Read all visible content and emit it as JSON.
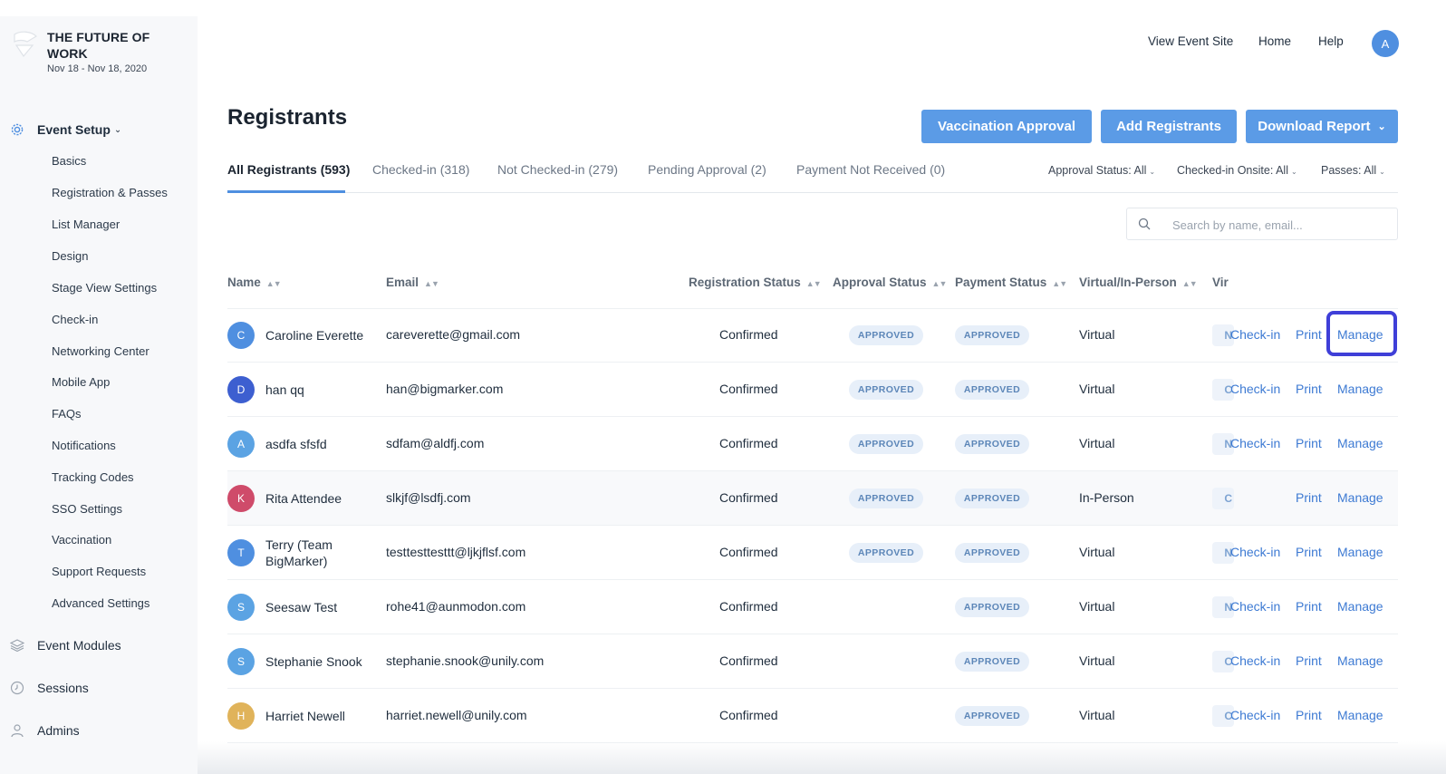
{
  "event": {
    "title": "THE FUTURE OF WORK",
    "dates": "Nov 18 - Nov 18, 2020"
  },
  "sidebar": {
    "event_setup": {
      "label": "Event Setup",
      "icon": "gear-icon"
    },
    "sub_items": [
      "Basics",
      "Registration & Passes",
      "List Manager",
      "Design",
      "Stage View Settings",
      "Check-in",
      "Networking Center",
      "Mobile App",
      "FAQs",
      "Notifications",
      "Tracking Codes",
      "SSO Settings",
      "Vaccination",
      "Support Requests",
      "Advanced Settings"
    ],
    "event_modules": {
      "label": "Event Modules",
      "icon": "layers-icon"
    },
    "sessions": {
      "label": "Sessions",
      "icon": "clock-icon"
    },
    "admins": {
      "label": "Admins",
      "icon": "user-icon"
    }
  },
  "topnav": {
    "view_event_site": "View Event Site",
    "home": "Home",
    "help": "Help",
    "avatar_initial": "A"
  },
  "page": {
    "title": "Registrants"
  },
  "buttons": {
    "vaccination_approval": "Vaccination Approval",
    "add_registrants": "Add Registrants",
    "download_report": "Download Report"
  },
  "tabs": [
    "All Registrants (593)",
    "Checked-in (318)",
    "Not Checked-in (279)",
    "Pending Approval (2)",
    "Payment Not Received (0)"
  ],
  "filters": {
    "approval_status": "Approval Status: All",
    "checked_in_onsite": "Checked-in Onsite: All",
    "passes": "Passes: All"
  },
  "search": {
    "placeholder": "Search by name, email..."
  },
  "table": {
    "headers": {
      "name": "Name",
      "email": "Email",
      "registration_status": "Registration Status",
      "approval_status": "Approval Status",
      "payment_status": "Payment Status",
      "virtual_in_person": "Virtual/In-Person",
      "vir": "Vir"
    },
    "action_labels": {
      "check_in": "Check-in",
      "print": "Print",
      "manage": "Manage"
    },
    "rows": [
      {
        "initial": "C",
        "avatar_color": "#4f8fe0",
        "name": "Caroline Everette",
        "email": "careverette@gmail.com",
        "registration_status": "Confirmed",
        "approval_status": "APPROVED",
        "payment_status": "APPROVED",
        "attendance": "Virtual",
        "vir": "N",
        "has_check_in": true
      },
      {
        "initial": "D",
        "avatar_color": "#3d5fd0",
        "name": "han qq",
        "email": "han@bigmarker.com",
        "registration_status": "Confirmed",
        "approval_status": "APPROVED",
        "payment_status": "APPROVED",
        "attendance": "Virtual",
        "vir": "C",
        "has_check_in": true
      },
      {
        "initial": "A",
        "avatar_color": "#5ba3e3",
        "name": "asdfa sfsfd",
        "email": "sdfam@aldfj.com",
        "registration_status": "Confirmed",
        "approval_status": "APPROVED",
        "payment_status": "APPROVED",
        "attendance": "Virtual",
        "vir": "N",
        "has_check_in": true
      },
      {
        "initial": "K",
        "avatar_color": "#cf4b6a",
        "name": "Rita Attendee",
        "email": "slkjf@lsdfj.com",
        "registration_status": "Confirmed",
        "approval_status": "APPROVED",
        "payment_status": "APPROVED",
        "attendance": "In-Person",
        "vir": "C",
        "has_check_in": false
      },
      {
        "initial": "T",
        "avatar_color": "#4f8fe0",
        "name": "Terry (Team BigMarker)",
        "email": "testtesttesttt@ljkjflsf.com",
        "registration_status": "Confirmed",
        "approval_status": "APPROVED",
        "payment_status": "APPROVED",
        "attendance": "Virtual",
        "vir": "N",
        "has_check_in": true
      },
      {
        "initial": "S",
        "avatar_color": "#5ba3e3",
        "name": "Seesaw Test",
        "email": "rohe41@aunmodon.com",
        "registration_status": "Confirmed",
        "approval_status": "",
        "payment_status": "APPROVED",
        "attendance": "Virtual",
        "vir": "N",
        "has_check_in": true
      },
      {
        "initial": "S",
        "avatar_color": "#5ba3e3",
        "name": "Stephanie Snook",
        "email": "stephanie.snook@unily.com",
        "registration_status": "Confirmed",
        "approval_status": "",
        "payment_status": "APPROVED",
        "attendance": "Virtual",
        "vir": "C",
        "has_check_in": true
      },
      {
        "initial": "H",
        "avatar_color": "#e0b35a",
        "name": "Harriet Newell",
        "email": "harriet.newell@unily.com",
        "registration_status": "Confirmed",
        "approval_status": "",
        "payment_status": "APPROVED",
        "attendance": "Virtual",
        "vir": "C",
        "has_check_in": true
      }
    ]
  },
  "colors": {
    "primary_button": "#5b9be6",
    "link": "#3d7ad3",
    "focus_ring": "#3f3fd8",
    "badge_bg": "#e7eff9"
  }
}
